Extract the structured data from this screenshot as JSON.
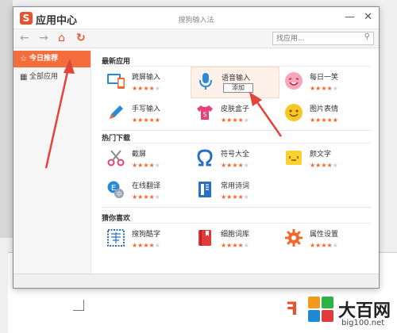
{
  "window": {
    "app_title": "应用中心",
    "subtitle": "搜狗输入法",
    "minimize_symbol": "—",
    "close_symbol": "✕"
  },
  "nav": {
    "back_symbol": "←",
    "forward_symbol": "→",
    "home_symbol": "⌂",
    "refresh_symbol": "↻",
    "search_placeholder": "找应用...",
    "search_symbol": "⚲"
  },
  "sidebar": {
    "items": [
      {
        "label": "今日推荐",
        "icon_symbol": "☆",
        "icon": "star-icon",
        "active": true
      },
      {
        "label": "全部应用",
        "icon_symbol": "▦",
        "icon": "grid-icon",
        "active": false
      }
    ]
  },
  "sections": [
    {
      "title": "最新应用",
      "apps": [
        {
          "name": "跨屏输入",
          "icon": "screen-devices-icon",
          "stars": 4
        },
        {
          "name": "语音输入",
          "icon": "microphone-icon",
          "stars": 4,
          "add_label": "添加"
        },
        {
          "name": "每日一笑",
          "icon": "smile-face-icon",
          "stars": 4
        },
        {
          "name": "手写输入",
          "icon": "pen-icon",
          "stars": 5
        },
        {
          "name": "皮肤盒子",
          "icon": "tshirt-icon",
          "stars": 4
        },
        {
          "name": "图片表情",
          "icon": "emoji-icon",
          "stars": 5
        }
      ]
    },
    {
      "title": "热门下载",
      "apps": [
        {
          "name": "截屏",
          "icon": "scissors-icon",
          "stars": 4
        },
        {
          "name": "符号大全",
          "icon": "omega-icon",
          "stars": 4
        },
        {
          "name": "颜文字",
          "icon": "kaomoji-icon",
          "stars": 4
        },
        {
          "name": "在线翻译",
          "icon": "translate-icon",
          "stars": 4
        },
        {
          "name": "常用诗词",
          "icon": "book-icon",
          "stars": 4
        }
      ]
    },
    {
      "title": "猜你喜欢",
      "apps": [
        {
          "name": "搜狗酷字",
          "icon": "stamp-icon",
          "stars": 4
        },
        {
          "name": "细胞词库",
          "icon": "red-book-icon",
          "stars": 4
        },
        {
          "name": "属性设置",
          "icon": "settings-gear-icon",
          "stars": 4
        }
      ]
    }
  ],
  "watermark": {
    "title": "大百网",
    "url": "big100.net"
  },
  "colors": {
    "accent": "#f46e3d",
    "brand_red": "#e8522d",
    "star": "#f0682b",
    "arrow": "#e2433a"
  }
}
